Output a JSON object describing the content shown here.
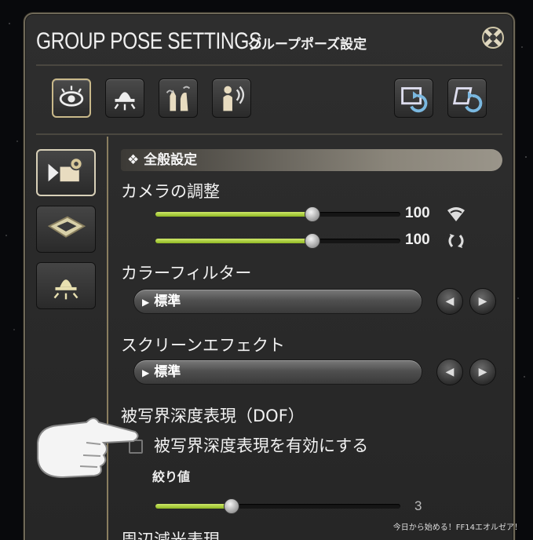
{
  "window": {
    "title_en": "GROUP POSE SETTINGS",
    "title_jp": "グループポーズ設定"
  },
  "toolbar": {
    "icons": [
      "eye-icon",
      "lamp-icon",
      "hand-pose-icon",
      "character-pose-icon",
      "undo-icon",
      "redo-icon"
    ]
  },
  "sidebar": {
    "icons": [
      "camera-settings-icon",
      "frame-icon",
      "light-icon"
    ]
  },
  "section": {
    "title": "全般設定"
  },
  "camera": {
    "label": "カメラの調整",
    "slider1_value": "100",
    "slider1_level": 0.64,
    "slider2_value": "100",
    "slider2_level": 0.64
  },
  "color_filter": {
    "label": "カラーフィルター",
    "selected": "標準"
  },
  "screen_effect": {
    "label": "スクリーンエフェクト",
    "selected": "標準"
  },
  "dof": {
    "label": "被写界深度表現（DOF）",
    "checkbox_label": "被写界深度表現を有効にする",
    "aperture_label": "絞り値",
    "aperture_value": "3",
    "aperture_level": 0.31
  },
  "vignette": {
    "label": "周辺減光表現"
  },
  "watermark": "今日から始める！FF14エオルゼア！",
  "colors": {
    "accent": "#a8cc3a",
    "frame": "#6e6858"
  }
}
